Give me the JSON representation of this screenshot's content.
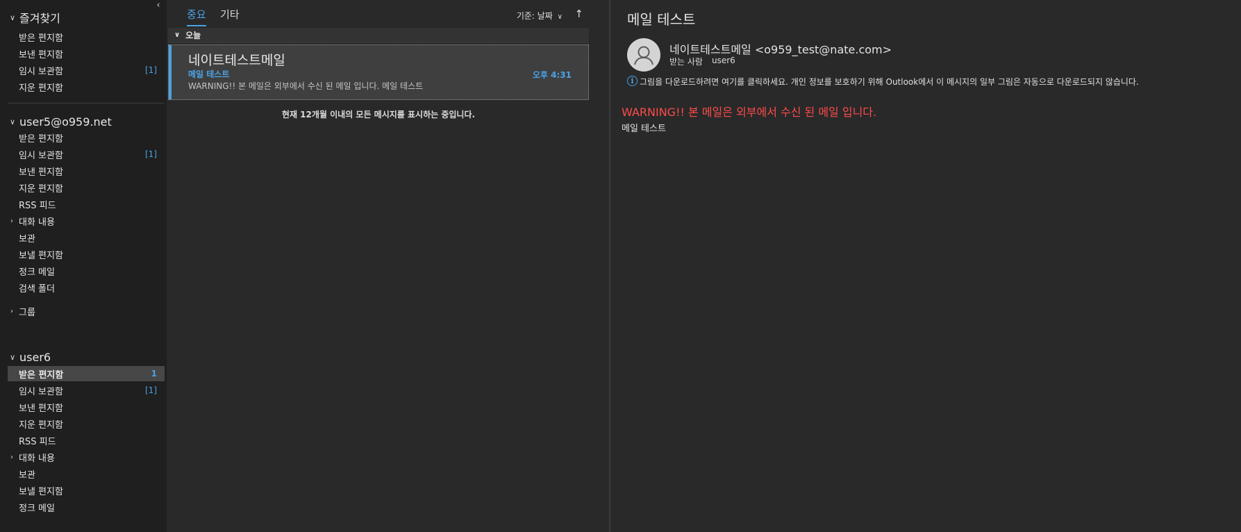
{
  "folder_pane": {
    "collapse_icon": "chevron-left-icon",
    "favorites": {
      "title": "즐겨찾기",
      "items": [
        {
          "label": "받은 편지함",
          "count": ""
        },
        {
          "label": "보낸 편지함",
          "count": ""
        },
        {
          "label": "임시 보관함",
          "count": "[1]"
        },
        {
          "label": "지운 편지함",
          "count": ""
        }
      ]
    },
    "account1": {
      "title": "user5@o959.net",
      "items": [
        {
          "label": "받은 편지함",
          "count": ""
        },
        {
          "label": "임시 보관함",
          "count": "[1]"
        },
        {
          "label": "보낸 편지함",
          "count": ""
        },
        {
          "label": "지운 편지함",
          "count": ""
        },
        {
          "label": "RSS 피드",
          "count": ""
        },
        {
          "label": "대화 내용",
          "count": ""
        },
        {
          "label": "보관",
          "count": ""
        },
        {
          "label": "보낼 편지함",
          "count": ""
        },
        {
          "label": "정크 메일",
          "count": ""
        },
        {
          "label": "검색 폴더",
          "count": ""
        }
      ],
      "groups_label": "그룹"
    },
    "account2": {
      "title": "user6",
      "items": [
        {
          "label": "받은 편지함",
          "count": "1"
        },
        {
          "label": "임시 보관함",
          "count": "[1]"
        },
        {
          "label": "보낸 편지함",
          "count": ""
        },
        {
          "label": "지운 편지함",
          "count": ""
        },
        {
          "label": "RSS 피드",
          "count": ""
        },
        {
          "label": "대화 내용",
          "count": ""
        },
        {
          "label": "보관",
          "count": ""
        },
        {
          "label": "보낼 편지함",
          "count": ""
        },
        {
          "label": "정크 메일",
          "count": ""
        }
      ]
    }
  },
  "message_list": {
    "tabs": [
      {
        "label": "중요",
        "active": true
      },
      {
        "label": "기타",
        "active": false
      }
    ],
    "sort_label": "기준: 날짜",
    "sort_direction_icon": "arrow-up-icon",
    "group_label": "오늘",
    "message": {
      "sender": "네이트테스트메일",
      "subject": "메일 테스트",
      "time": "오후 4:31",
      "preview": "WARNING!! 본 메일은 외부에서 수신 된 메일 입니다.  메일 테스트"
    },
    "notice": "현재 12개월 이내의 모든 메시지를 표시하는 중입니다."
  },
  "reading_pane": {
    "title": "메일 테스트",
    "from": "네이트테스트메일 <o959_test@nate.com>",
    "to_label": "받는 사람",
    "to": "user6",
    "info_text": "그림을 다운로드하려면 여기를 클릭하세요. 개인 정보를 보호하기 위해 Outlook에서 이 메시지의 일부 그림은 자동으로 다운로드되지 않습니다.",
    "body_warning": "WARNING!! 본 메일은 외부에서 수신 된 메일 입니다.",
    "body_text": "메일 테스트"
  },
  "colors": {
    "accent": "#4aa3e6",
    "warning": "#ff4b4b",
    "folder_bg": "#1f1f1f",
    "pane_bg": "#292929"
  }
}
